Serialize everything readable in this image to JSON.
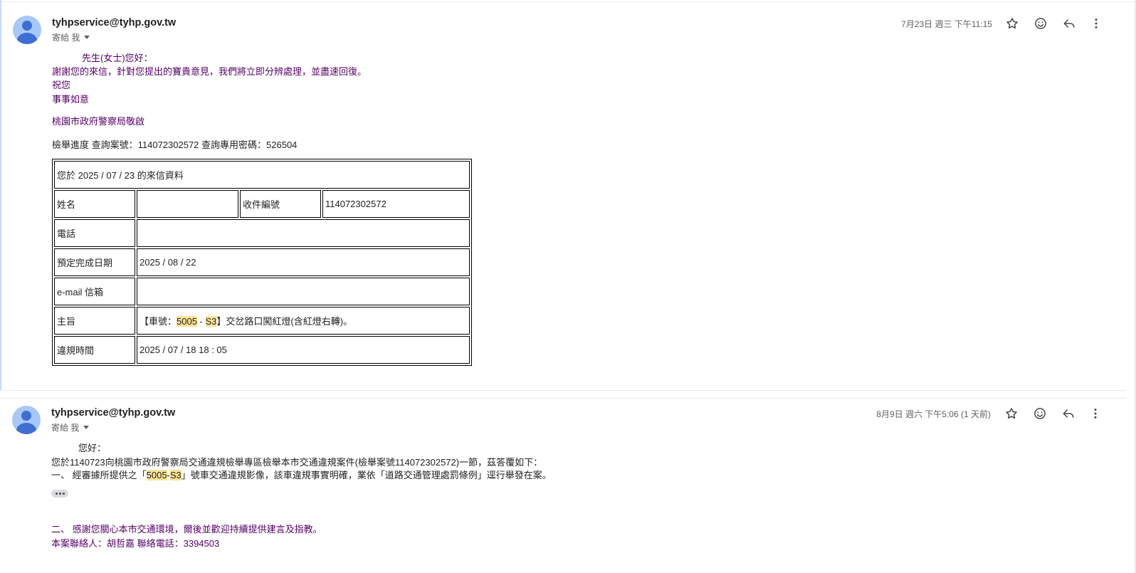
{
  "messages": [
    {
      "sender": "tyhpservice@tyhp.gov.tw",
      "to_label": "寄給 我",
      "date": "7月23日 週三 下午11:15",
      "greeting": "先生(女士)您好：",
      "lines": [
        "謝謝您的來信，針對您提出的寶貴意見，我們將立即分辨處理，並盡速回復。",
        "祝您",
        "事事如意"
      ],
      "signature": "桃園市政府警察局敬啟",
      "query_line": "檢舉進度 查詢案號：114072302572 查詢專用密碼：526504",
      "table": {
        "header": "您於 2025 / 07 / 23 的來信資料",
        "name_label": "姓名",
        "name_value": "",
        "receipt_label": "收件編號",
        "receipt_value": "114072302572",
        "phone_label": "電話",
        "phone_value": "",
        "due_label": "預定完成日期",
        "due_value": "2025 / 08 / 22",
        "email_label": "e-mail 信箱",
        "email_value": "",
        "subject_label": "主旨",
        "subject_prefix": "【車號：",
        "plate_a": "5005",
        "plate_sep": " - ",
        "plate_b": "S3",
        "subject_suffix": "】交岔路口闖紅燈(含紅燈右轉)。",
        "time_label": "違規時間",
        "time_value": "2025 / 07 / 18 18 : 05"
      }
    },
    {
      "sender": "tyhpservice@tyhp.gov.tw",
      "to_label": "寄給 我",
      "date": "8月9日 週六 下午5:06 (1 天前)",
      "greeting": "您好：",
      "line1": "您於1140723向桃園市政府警察局交通違規檢舉專區檢舉本市交通違規案件(檢舉案號114072302572)一節，茲答覆如下：",
      "line2_prefix": "一、 經審據所提供之「",
      "plate_a": "5005",
      "plate_sep": "-",
      "plate_b": "S3",
      "line2_suffix": "」號車交通違規影像，該車違規事實明確，業依「道路交通管理處罰條例」逕行舉發在案。",
      "line3": "二、 感謝您關心本市交通環境，爾後並歡迎持續提供建言及指教。",
      "line4": "本案聯絡人：胡哲嘉 聯絡電話：3394503"
    }
  ],
  "icons": [
    "star-icon",
    "emoji-icon",
    "reply-icon",
    "more-vert-icon"
  ]
}
